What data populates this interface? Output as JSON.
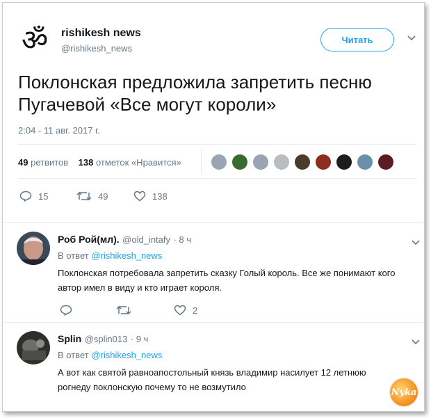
{
  "account": {
    "name": "rishikesh news",
    "handle": "@rishikesh_news",
    "logo_glyph": "ॐ",
    "follow_label": "Читать"
  },
  "tweet": {
    "text": "Поклонская предложила запретить песню Пугачевой «Все могут короли»",
    "time": "2:04 - 11 авг. 2017 г.",
    "retweets_count": "49",
    "retweets_label": "ретвитов",
    "likes_count": "138",
    "likes_label": "отметок «Нравится»",
    "actions": {
      "replies": "15",
      "retweets": "49",
      "likes": "138"
    }
  },
  "replies": [
    {
      "name": "Роб Рой(мл).",
      "handle": "@old_intafy",
      "time": "· 8 ч",
      "in_reply_prefix": "В ответ",
      "in_reply_to": "@rishikesh_news",
      "text": "Поклонская потребовала запретить сказку Голый король. Все  же понимают кого автор имел в виду и кто играет короля.",
      "likes": "2"
    },
    {
      "name": "Splin",
      "handle": "@splin013",
      "time": "· 9 ч",
      "in_reply_prefix": "В ответ",
      "in_reply_to": "@rishikesh_news",
      "text": "А вот как святой равноапостольный князь владимир насилует 12 летнюю рогнеду поклонскую почему то не возмутило"
    }
  ],
  "watermark": "Nyka",
  "colors": {
    "accent": "#1da1f2",
    "muted": "#657786",
    "text": "#14171a",
    "divider": "#e6ecf0"
  },
  "icons": {
    "reply": "reply-icon",
    "retweet": "retweet-icon",
    "like": "heart-icon",
    "menu": "chevron-down-icon"
  }
}
